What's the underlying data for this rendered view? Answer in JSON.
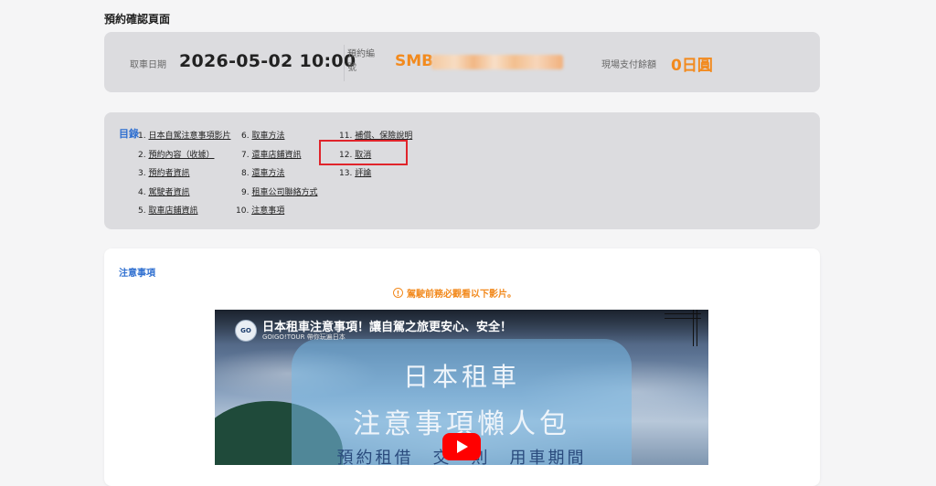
{
  "page": {
    "title": "預約確認頁面"
  },
  "summary": {
    "pickup_label": "取車日期",
    "pickup_value": "2026-05-02 10:00",
    "reservation_label": "預約編號",
    "reservation_value_visible": "SMB",
    "payment_label": "現場支付餘額",
    "payment_value": "0日圓"
  },
  "toc": {
    "title": "目錄",
    "items": [
      {
        "num": "1. ",
        "label": "日本自駕注意事項影片"
      },
      {
        "num": "2. ",
        "label": "預約內容（收據）"
      },
      {
        "num": "3. ",
        "label": "預約者資訊"
      },
      {
        "num": "4. ",
        "label": "駕駛者資訊"
      },
      {
        "num": "5. ",
        "label": "取車店鋪資訊"
      },
      {
        "num": "6. ",
        "label": "取車方法"
      },
      {
        "num": "7. ",
        "label": "還車店鋪資訊"
      },
      {
        "num": "8. ",
        "label": "還車方法"
      },
      {
        "num": "9. ",
        "label": "租車公司聯絡方式"
      },
      {
        "num": "10. ",
        "label": "注意事項"
      },
      {
        "num": "11. ",
        "label": "補償、保險說明"
      },
      {
        "num": "12. ",
        "label": "取消"
      },
      {
        "num": "13. ",
        "label": "評論"
      }
    ]
  },
  "notes": {
    "title": "注意事項",
    "warning": "駕駛前務必觀看以下影片。",
    "warning_icon": "!",
    "video": {
      "title": "日本租車注意事項！讓自駕之旅更安心、安全！",
      "channel": "GOIGO!TOUR 帶你玩遍日本",
      "avatar_text": "GO",
      "line1": "日本租車",
      "line2": "注意事項懶人包",
      "line3": "預約租借　交　則　用車期間"
    }
  },
  "colors": {
    "accent_orange": "#f28a1e",
    "link_blue": "#2f6fd0",
    "highlight_red": "#e0242b"
  }
}
